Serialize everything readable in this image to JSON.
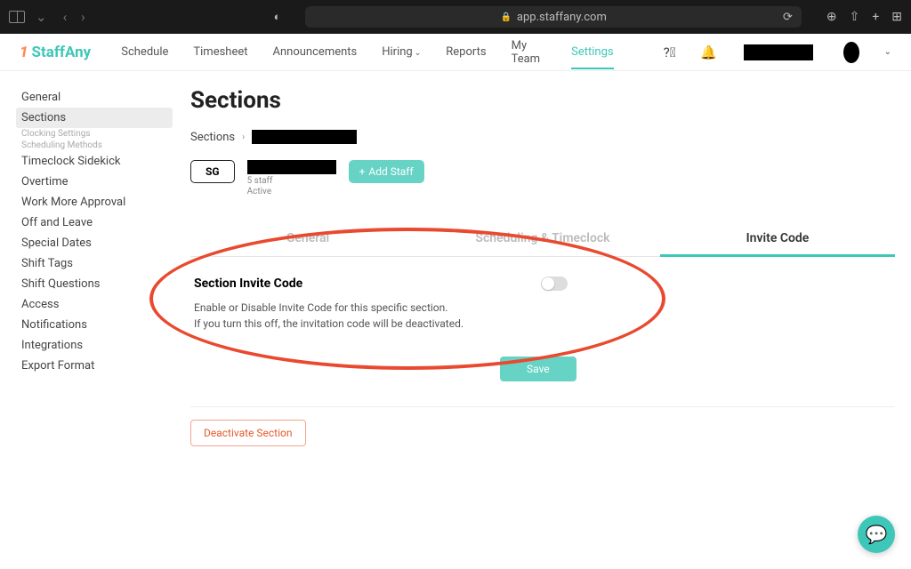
{
  "browser": {
    "url": "app.staffany.com"
  },
  "brand": {
    "name": "StaffAny"
  },
  "nav": {
    "items": [
      "Schedule",
      "Timesheet",
      "Announcements",
      "Hiring",
      "Reports",
      "My Team",
      "Settings"
    ]
  },
  "sidebar": {
    "items": [
      "General",
      "Sections",
      "Timeclock Sidekick",
      "Overtime",
      "Work More Approval",
      "Off and Leave",
      "Special Dates",
      "Shift Tags",
      "Shift Questions",
      "Access",
      "Notifications",
      "Integrations",
      "Export Format"
    ],
    "subitems": [
      "Clocking Settings",
      "Scheduling Methods"
    ]
  },
  "page": {
    "title": "Sections",
    "breadcrumb_root": "Sections",
    "chip": "SG",
    "staff_count": "5 staff",
    "status": "Active",
    "add_staff": "Add Staff",
    "tabs": [
      "General",
      "Scheduling & Timeclock",
      "Invite Code"
    ],
    "panel_title": "Section Invite Code",
    "panel_line1": "Enable or Disable Invite Code for this specific section.",
    "panel_line2": "If you turn this off, the invitation code will be deactivated.",
    "save": "Save",
    "deactivate": "Deactivate Section"
  }
}
